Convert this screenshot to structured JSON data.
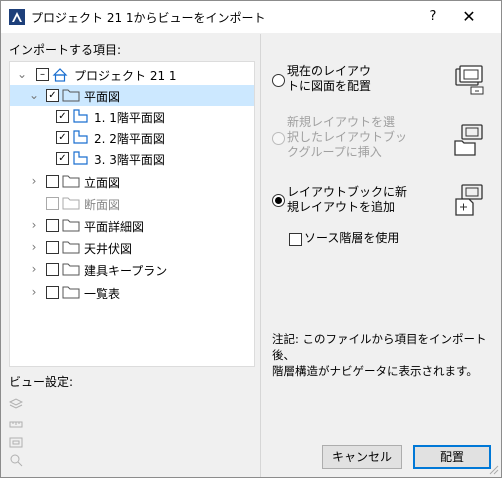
{
  "window": {
    "title": "プロジェクト 21 1からビューをインポート",
    "help_label": "?",
    "close_label": "✕"
  },
  "import_items": {
    "label": "インポートする項目:",
    "tree": [
      {
        "label": "プロジェクト 21 1",
        "checked": "partial",
        "expanded": true
      },
      {
        "label": "平面図",
        "checked": true,
        "expanded": true,
        "selected": true
      },
      {
        "label": "1. 1階平面図",
        "checked": true
      },
      {
        "label": "2. 2階平面図",
        "checked": true
      },
      {
        "label": "3. 3階平面図",
        "checked": true
      },
      {
        "label": "立面図",
        "checked": false
      },
      {
        "label": "断面図",
        "checked": false,
        "disabled": true
      },
      {
        "label": "平面詳細図",
        "checked": false
      },
      {
        "label": "天井伏図",
        "checked": false
      },
      {
        "label": "建具キープラン",
        "checked": false
      },
      {
        "label": "一覧表",
        "checked": false
      }
    ]
  },
  "view_settings": {
    "label": "ビュー設定:",
    "icons": [
      "layers-icon",
      "scale-icon",
      "model-view-icon",
      "zoom-icon"
    ]
  },
  "placement_options": [
    {
      "line1": "現在のレイアウ",
      "line2": "トに図面を配置",
      "line3": "",
      "selected": false,
      "disabled": false,
      "icon": "place-in-layout-icon"
    },
    {
      "line1": "新規レイアウトを選",
      "line2": "択したレイアウトブッ",
      "line3": "クグループに挿入",
      "selected": false,
      "disabled": true,
      "icon": "insert-into-folder-icon"
    },
    {
      "line1": "レイアウトブックに新",
      "line2": "規レイアウトを追加",
      "line3": "",
      "selected": true,
      "disabled": false,
      "icon": "new-layout-icon"
    }
  ],
  "source_hierarchy": {
    "label": "ソース階層を使用",
    "checked": false
  },
  "note": {
    "line1": "注記: このファイルから項目をインポート後、",
    "line2": "階層構造がナビゲータに表示されます。"
  },
  "buttons": {
    "cancel": "キャンセル",
    "place": "配置"
  },
  "colors": {
    "selection": "#cce8ff",
    "primary_border": "#0078d7",
    "icon_blue": "#1a6fd0"
  }
}
